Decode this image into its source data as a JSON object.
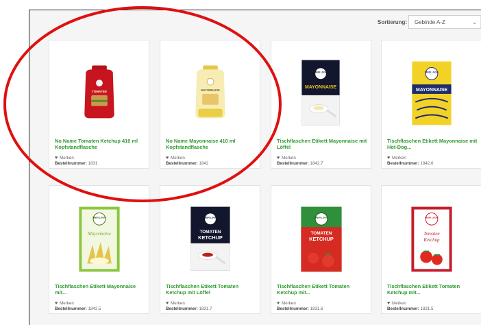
{
  "sort": {
    "label": "Sortierung:",
    "value": "Gebinde A-Z"
  },
  "fav_label": "Merken",
  "order_label": "Bestellnummer:",
  "products": [
    {
      "title": "No Name Tomaten Ketchup 410 ml Kopfstandflasche",
      "order": "1831"
    },
    {
      "title": "No Name Mayonnaise 410 ml Kopfstandflasche",
      "order": "1842"
    },
    {
      "title": "Tischflaschen Etikett Mayonnaise mit Löffel",
      "order": "1842.7"
    },
    {
      "title": "Tischflaschen Etikett Mayonnaise mit Hot-Dog...",
      "order": "1842.6"
    },
    {
      "title": "Tischflaschen Etikett Mayonnaise mit...",
      "order": "1842.5"
    },
    {
      "title": "Tischflaschen Etikett Tomaten Ketchup mit Löffel",
      "order": "1831.7"
    },
    {
      "title": "Tischflaschen Etikett Tomaten Ketchup mit...",
      "order": "1831.6"
    },
    {
      "title": "Tischflaschen Etikett Tomaten Ketchup mit...",
      "order": "1831.5"
    }
  ],
  "logo_text": "MEIN LOGO",
  "label_texts": {
    "ketchup_bottle": "TOMATEN",
    "mayo_bottle": "MAYONNAISE",
    "mayo_upper": "MAYONNAISE",
    "mayo_italic": "Mayonnaise",
    "ketchup_upper_1": "TOMATEN",
    "ketchup_upper_2": "KETCHUP",
    "ketchup_script_1": "Tomaten",
    "ketchup_script_2": "Ketchup"
  },
  "colors": {
    "title_green": "#2f9a2f",
    "highlight_red": "#e01010"
  },
  "icons": [
    "heart-icon",
    "chevron-down-icon"
  ]
}
